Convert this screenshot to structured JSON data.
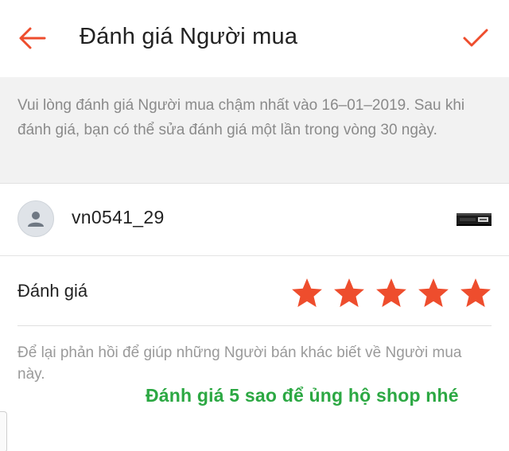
{
  "colors": {
    "accent": "#ee4d2d",
    "promo": "#2ca843",
    "notice_bg": "#f2f2f2"
  },
  "header": {
    "back_icon": "arrow-left-icon",
    "title": "Đánh giá Người mua",
    "confirm_icon": "checkmark-icon"
  },
  "notice": {
    "text": "Vui lòng đánh giá Người mua chậm nhất vào 16–01–2019. Sau khi đánh giá, bạn có thể sửa đánh giá một lần trong vòng 30 ngày."
  },
  "buyer": {
    "avatar_icon": "user-icon",
    "username": "vn0541_29"
  },
  "rating": {
    "label": "Đánh giá",
    "value": 5,
    "max": 5
  },
  "feedback": {
    "hint": "Để lại phản hồi để giúp những Người bán khác biết về Người mua này."
  },
  "promo": {
    "text": "Đánh giá 5 sao để ủng hộ shop nhé"
  }
}
